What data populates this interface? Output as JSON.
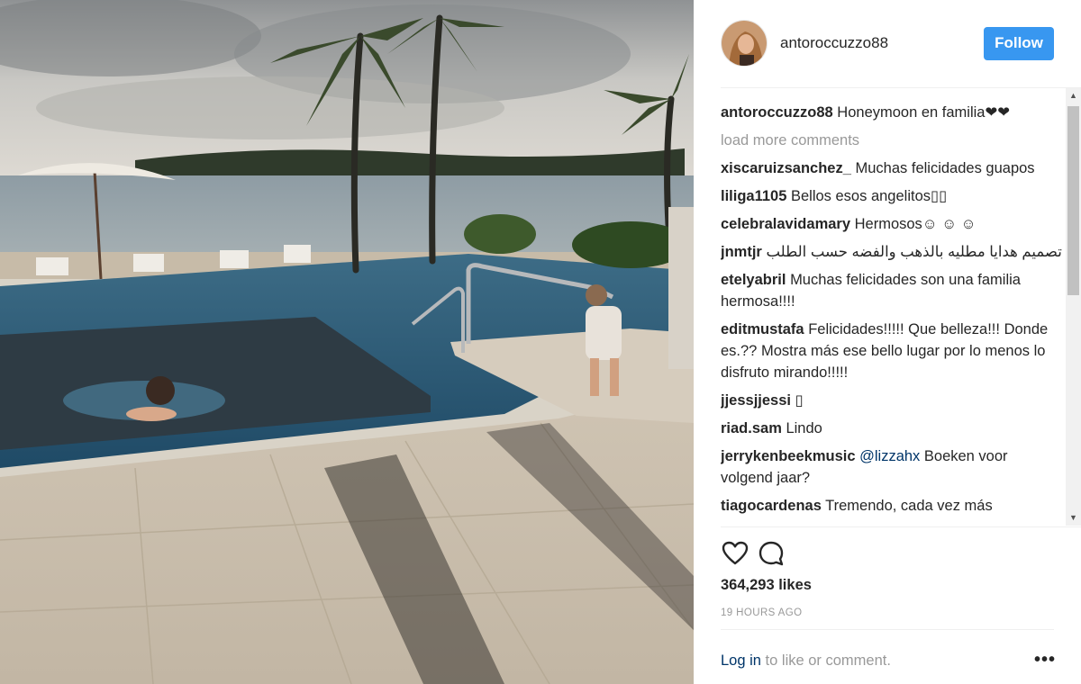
{
  "post": {
    "username": "antoroccuzzo88",
    "follow_label": "Follow",
    "caption_user": "antoroccuzzo88",
    "caption_text": "Honeymoon en familia❤❤",
    "load_more": "load more comments",
    "likes": "364,293 likes",
    "timestamp": "19 HOURS AGO",
    "login_link": "Log in",
    "login_rest": " to like or comment.",
    "more_label": "•••"
  },
  "comments": [
    {
      "user": "xiscaruizsanchez_",
      "text": "Muchas felicidades guapos"
    },
    {
      "user": "liliga1105",
      "text": "Bellos esos angelitos▯▯"
    },
    {
      "user": "celebralavidamary",
      "text": "Hermosos☺ ☺ ☺"
    },
    {
      "user": "jnmtjr",
      "text": "تصميم هدايا مطليه بالذهب والفضه حسب الطلب"
    },
    {
      "user": "etelyabril",
      "text": "Muchas felicidades son una familia hermosa!!!!"
    },
    {
      "user": "editmustafa",
      "text": "Felicidades!!!!! Que belleza!!! Donde es.?? Mostra más ese bello lugar por lo menos lo disfruto mirando!!!!!"
    },
    {
      "user": "jjessjjessi",
      "text": "▯"
    },
    {
      "user": "riad.sam",
      "text": "Lindo"
    },
    {
      "user": "jerrykenbeekmusic",
      "mention": "@lizzahx",
      "text": " Boeken voor volgend jaar?"
    },
    {
      "user": "tiagocardenas",
      "text": "Tremendo, cada vez más"
    }
  ],
  "icons": {
    "like": "heart-icon",
    "comment": "comment-icon",
    "more": "more-options-icon",
    "scroll_up": "▲",
    "scroll_down": "▼"
  },
  "colors": {
    "follow_button": "#3897f0",
    "link": "#003569",
    "muted": "#999999"
  }
}
